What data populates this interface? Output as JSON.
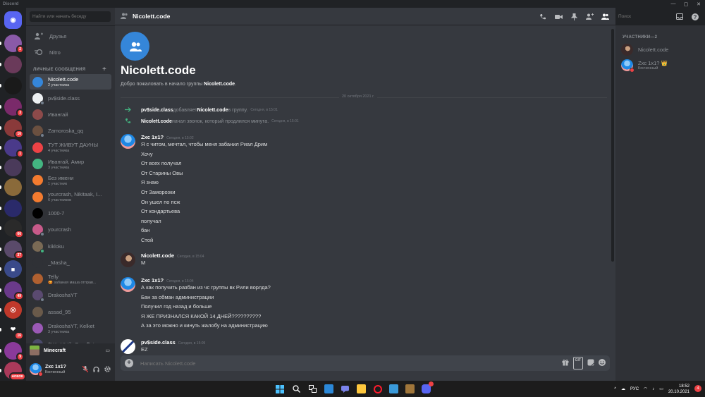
{
  "window": {
    "title": "Discord"
  },
  "sidebar": {
    "search_placeholder": "Найти или начать беседу",
    "nav": [
      {
        "label": "Друзья"
      },
      {
        "label": "Nitro"
      }
    ],
    "dm_header": "ЛИЧНЫЕ СООБЩЕНИЯ",
    "dms": [
      {
        "name": "Nicolett.code",
        "sub": "2 участника",
        "color": "#3586d9",
        "selected": true
      },
      {
        "name": "pv$side.class",
        "sub": "",
        "color": "#eceff1"
      },
      {
        "name": "Ивангай",
        "sub": "",
        "color": "#8d4a4a"
      },
      {
        "name": "Zamoroska_qq",
        "sub": "",
        "color": "#6b5040"
      },
      {
        "name": "ТУТ ЖИВУТ ДАУНЫ",
        "sub": "4 участника",
        "color": "#ed4245"
      },
      {
        "name": "Ивангай, Амир",
        "sub": "3 участника",
        "color": "#43b581"
      },
      {
        "name": "Без имени",
        "sub": "1 участник",
        "color": "#f47b2f"
      },
      {
        "name": "yourcrash, Nikitaak, I...",
        "sub": "6 участников",
        "color": "#f47b2f"
      },
      {
        "name": "1000-7",
        "sub": "",
        "color": "#000000"
      },
      {
        "name": "yourcrash",
        "sub": "",
        "color": "#c75a8a"
      },
      {
        "name": "kikloku",
        "sub": "",
        "color": "#7a6a55"
      },
      {
        "name": "_Masha_",
        "sub": "",
        "color": "#2f3136"
      },
      {
        "name": "Telly",
        "sub": "😡 забаная маша отправ...",
        "color": "#b06030"
      },
      {
        "name": "DrakoshaYT",
        "sub": "",
        "color": "#5a4a70"
      },
      {
        "name": "assad_95",
        "sub": "",
        "color": "#6a5a4a"
      },
      {
        "name": "DrakoshaYT, Kelket",
        "sub": "3 участника",
        "color": "#9b59b6"
      },
      {
        "name": "$ЧёоНЫй_ОгонЁк⁺-...",
        "sub": "",
        "color": "#4a4a6a"
      }
    ],
    "activity": {
      "name": "Minecraft"
    },
    "user": {
      "name": "Zxc 1x1?",
      "status": "Конченный"
    }
  },
  "servers": [
    {
      "badge": "",
      "color": "#5865f2",
      "glyph": "◉"
    },
    {
      "badge": "2",
      "color": "#8a5aa8",
      "glyph": ""
    },
    {
      "badge": "",
      "color": "#6a3a5a",
      "glyph": ""
    },
    {
      "badge": "",
      "color": "#1a1a1a",
      "glyph": ""
    },
    {
      "badge": "3",
      "color": "#7a2a6a",
      "glyph": ""
    },
    {
      "badge": "16",
      "color": "#8a3a3a",
      "glyph": ""
    },
    {
      "badge": "1",
      "color": "#4a3a8a",
      "glyph": ""
    },
    {
      "badge": "",
      "color": "#4a3a5a",
      "glyph": ""
    },
    {
      "badge": "",
      "color": "#8a6a3a",
      "glyph": ""
    },
    {
      "badge": "",
      "color": "#2a2a6a",
      "glyph": ""
    },
    {
      "badge": "66",
      "color": "#2a2a2a",
      "glyph": ""
    },
    {
      "badge": "37",
      "color": "#5a4a6a",
      "glyph": ""
    },
    {
      "badge": "",
      "color": "#3a4a8a",
      "glyph": "■"
    },
    {
      "badge": "49",
      "color": "#6a3a8a",
      "glyph": ""
    },
    {
      "badge": "",
      "color": "#c0392b",
      "glyph": "◎"
    },
    {
      "badge": "16",
      "color": "#202225",
      "glyph": "❤"
    },
    {
      "badge": "9",
      "color": "#8a3a9a",
      "glyph": ""
    },
    {
      "badge": "НОВОЕ",
      "color": "#aa3a5a",
      "glyph": ""
    }
  ],
  "chat": {
    "title": "Nicolett.code",
    "search_placeholder": "Поиск",
    "intro_title": "Nicolett.code",
    "intro_prefix": "Добро пожаловать в начало группы ",
    "intro_name": "Nicolett.code",
    "intro_suffix": ".",
    "date_divider": "20 октября 2021 г.",
    "system": [
      {
        "actor": "pv$side.class",
        "text1": " добавляет ",
        "target": "Nicolett.code",
        "text2": " в группу.",
        "time": "Сегодня, в 15:01"
      },
      {
        "actor": "Nicolett.code",
        "text1": " начал звонок, который продлился минута.",
        "target": "",
        "text2": "",
        "time": "Сегодня, в 15:01"
      }
    ],
    "messages": [
      {
        "author": "Zxc 1x1?",
        "time": "Сегодня, в 15:02",
        "lines": [
          "Я с читом, мечтал, чтобы меня забанил Риал Дрим",
          "Хочу",
          "От всех получал",
          "От Старины Овы",
          "Я знаю",
          "От Заморозки",
          "Он ушел по псж",
          "От кондартьева",
          "получал",
          "бан",
          "Стой"
        ]
      },
      {
        "author": "Nicolett.code",
        "time": "Сегодня, в 15:04",
        "lines": [
          "М"
        ]
      },
      {
        "author": "Zxc 1x1?",
        "time": "Сегодня, в 15:04",
        "lines": [
          "А как получить разбан из чс группы вк Рили ворлда?",
          "Бан за обман администрации",
          "Получил год назад и больше",
          "Я ЖЕ ПРИЗНАЛСЯ КАКОЙ 14 ДНЕЙ??????????",
          "А за это можно и кинуть жалобу на администрацию"
        ]
      },
      {
        "author": "pv$side.class",
        "time": "Сегодня, в 15:05",
        "lines": [
          "EZ"
        ]
      }
    ],
    "input_placeholder": "Написать Nicolett.code",
    "gif_label": "GIF"
  },
  "members": {
    "header": "УЧАСТНИКИ—2",
    "list": [
      {
        "name": "Nicolett.code",
        "sub": ""
      },
      {
        "name": "Zxc 1x1? 👑",
        "sub": "Конченный"
      }
    ]
  },
  "taskbar": {
    "lang": "РУС",
    "time": "18:52",
    "date": "20.10.2021",
    "notif": "4"
  }
}
